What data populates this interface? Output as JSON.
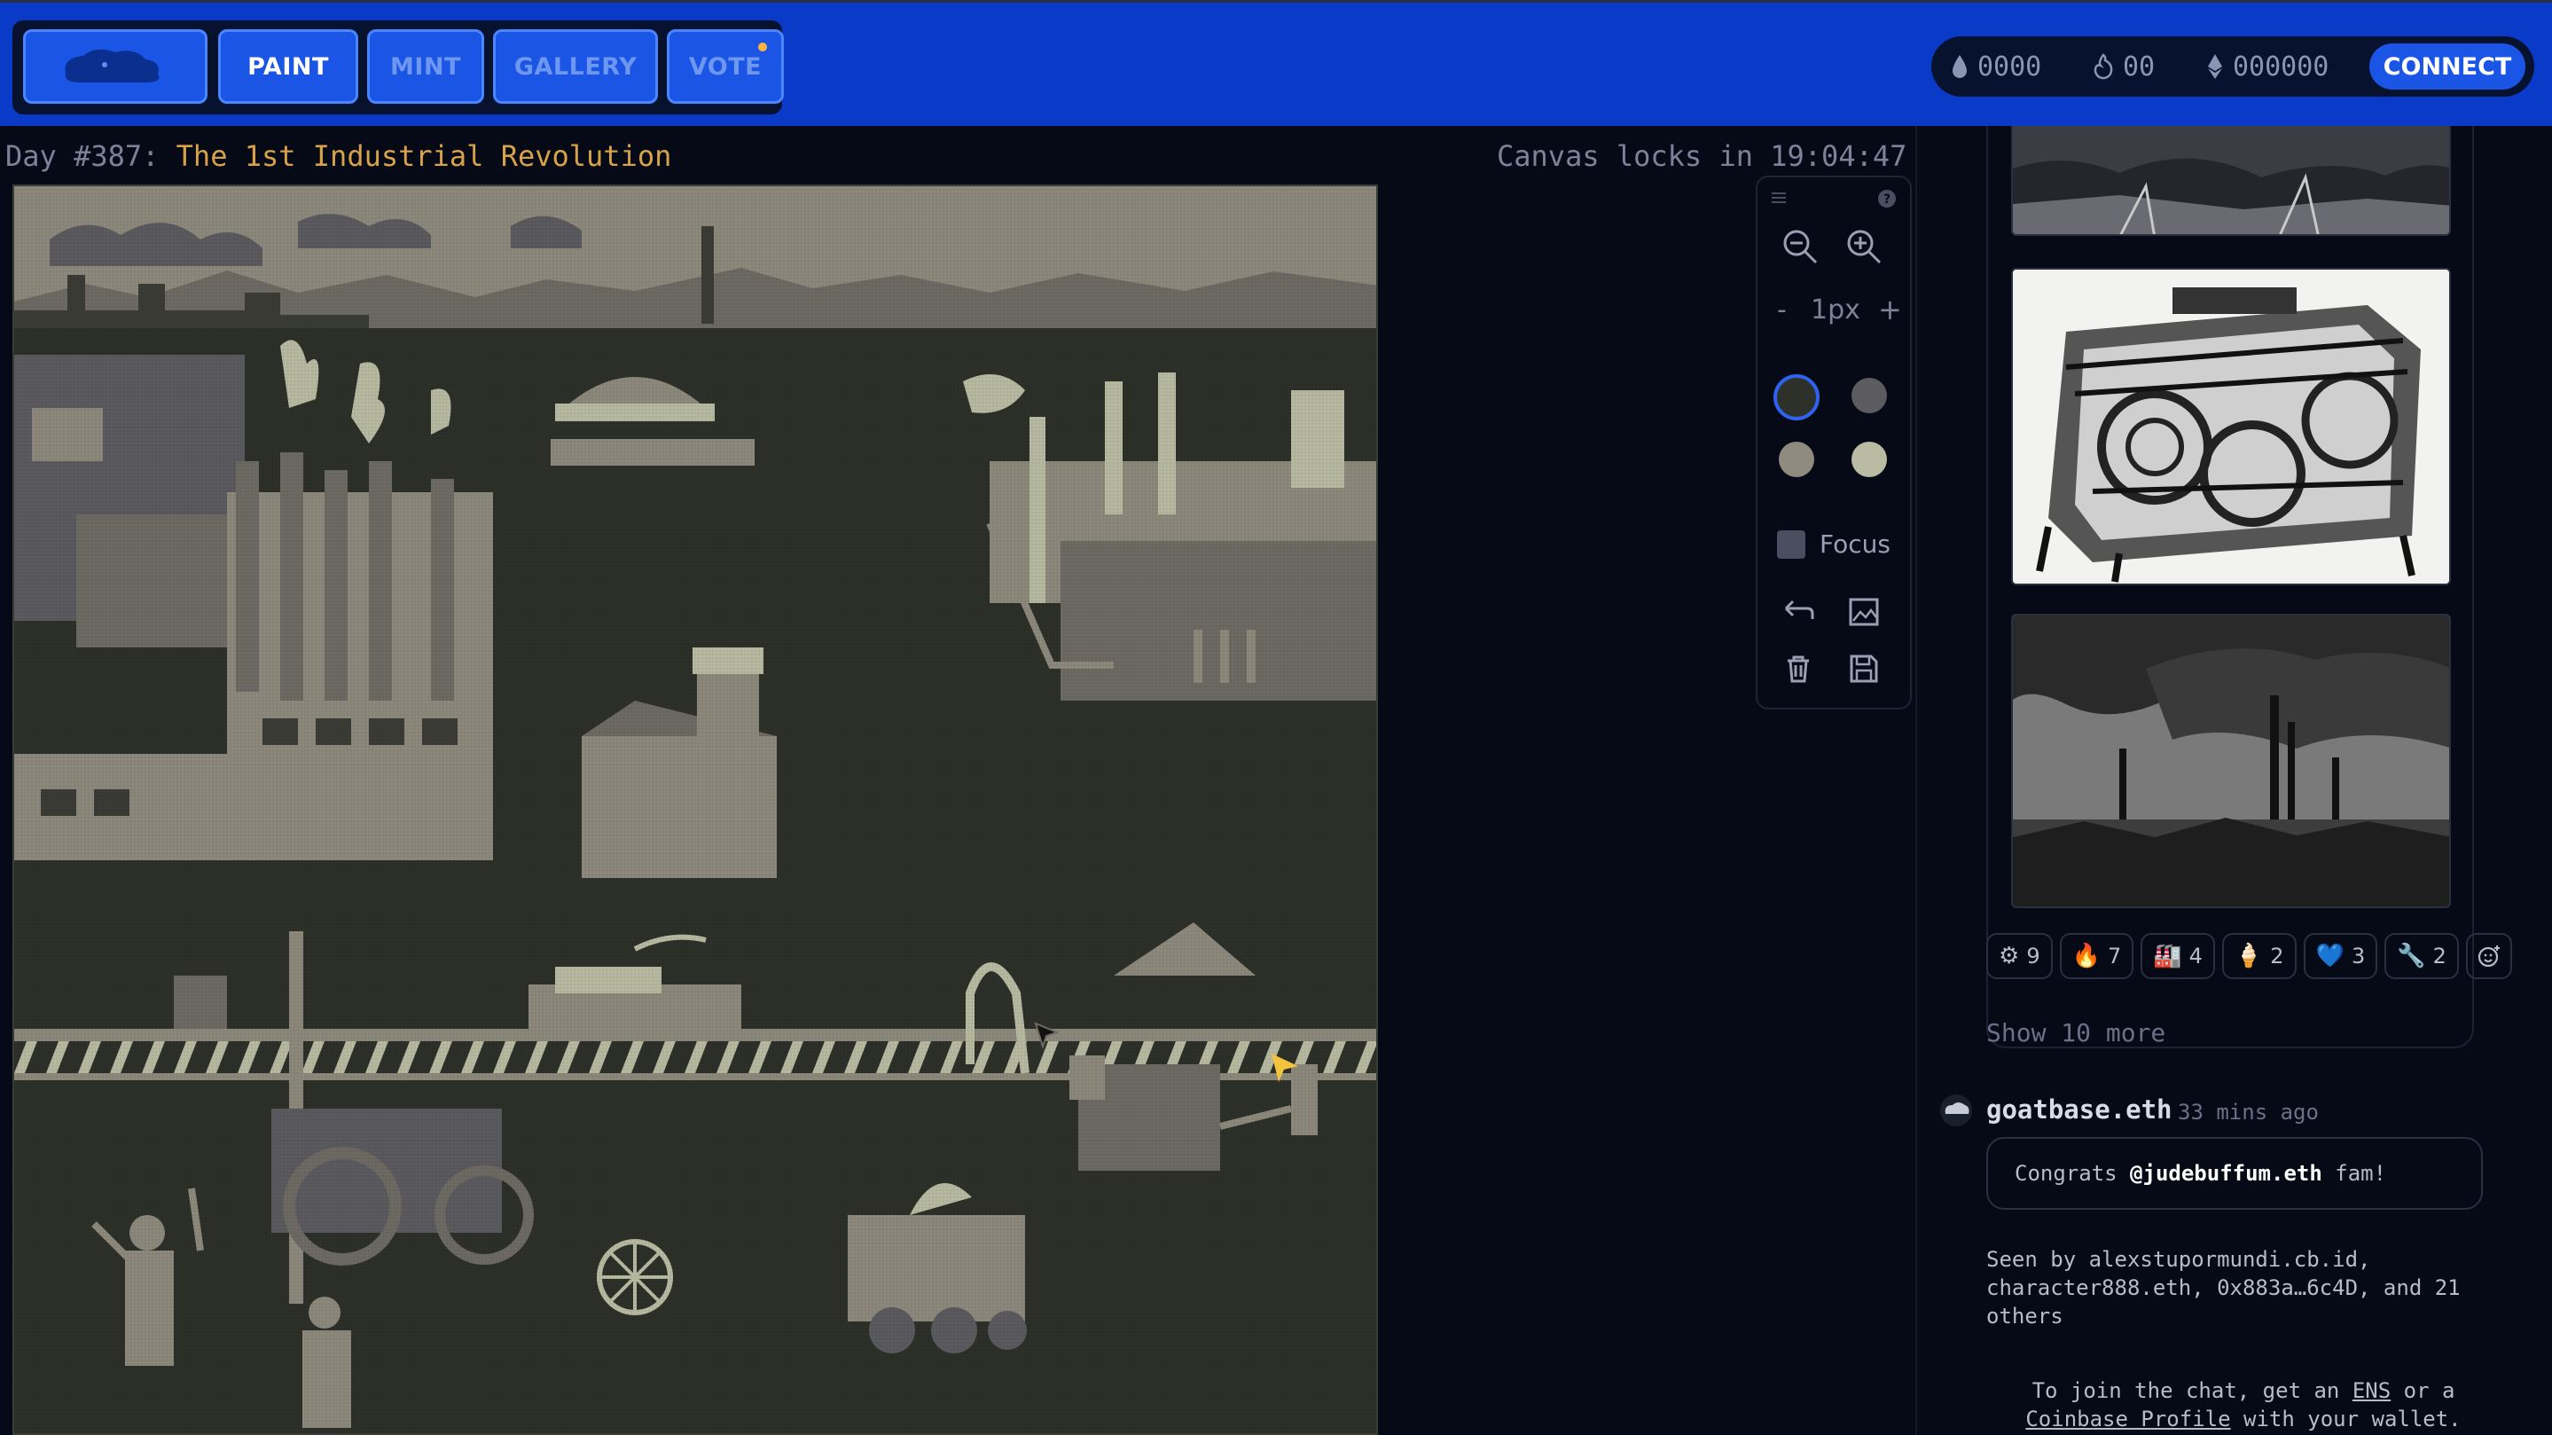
{
  "nav": {
    "logo_icon": "cloud-goat-logo",
    "paint_label": "PAINT",
    "mint_label": "MINT",
    "gallery_label": "GALLERY",
    "vote_label": "VOTE",
    "accent": "#1a55e6"
  },
  "wallet": {
    "drops": "0000",
    "fire": "00",
    "eth": "000000",
    "connect_label": "CONNECT"
  },
  "header": {
    "day_prefix": "Day #387: ",
    "theme": "The 1st Industrial Revolution",
    "lock_text": "Canvas locks in 19:04:47"
  },
  "tools": {
    "zoom_value": "1px",
    "minus": "-",
    "plus": "+",
    "palette": [
      "#2e3129",
      "#5c5b60",
      "#8e8a7d",
      "#b9bca2"
    ],
    "selected_color_index": 0,
    "focus_label": "Focus"
  },
  "reactions": [
    {
      "emoji": "⚙",
      "count": "9"
    },
    {
      "emoji": "🔥",
      "count": "7"
    },
    {
      "emoji": "🏭",
      "count": "4"
    },
    {
      "emoji": "🍦",
      "count": "2"
    },
    {
      "emoji": "💙",
      "count": "3"
    },
    {
      "emoji": "🔧",
      "count": "2"
    }
  ],
  "chat": {
    "show_more": "Show 10 more",
    "user": "goatbase.eth",
    "time": "33 mins ago",
    "msg_pre": "Congrats ",
    "msg_mention": "@judebuffum.eth",
    "msg_post": " fam!",
    "seen": "Seen by alexstupormundi.cb.id, character888.eth, 0x883a…6c4D, and 21 others",
    "join_1": "To join the chat, get an ",
    "join_ens": "ENS",
    "join_2": " or a",
    "join_cb": "Coinbase Profile",
    "join_3": " with your wallet."
  }
}
